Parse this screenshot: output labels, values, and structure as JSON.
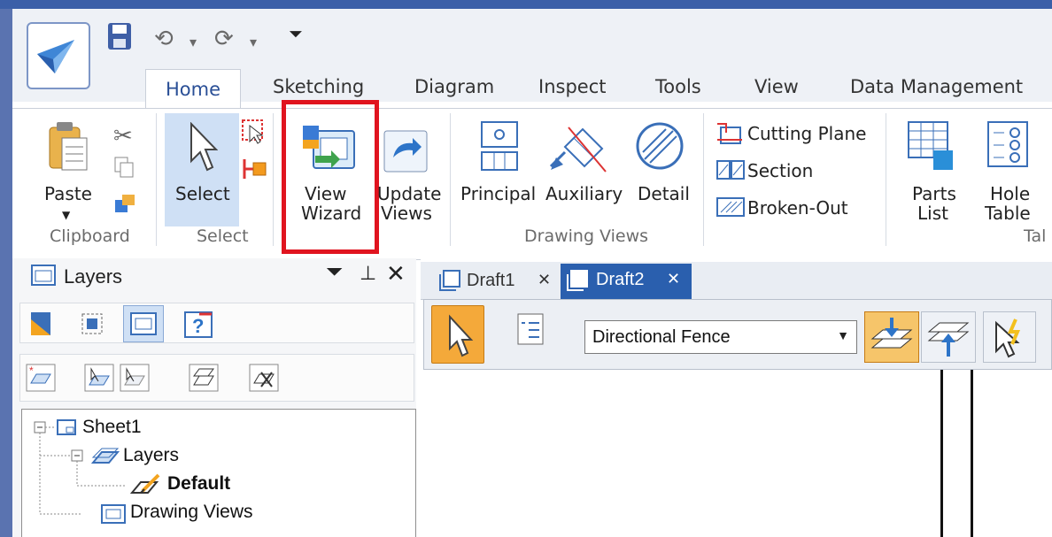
{
  "ribbon_tabs": [
    "Home",
    "Sketching",
    "Diagram",
    "Inspect",
    "Tools",
    "View",
    "Data Management"
  ],
  "clipboard": {
    "paste": "Paste",
    "group": "Clipboard"
  },
  "select": {
    "select": "Select",
    "group": "Select"
  },
  "drawing_views": {
    "view_wizard_line1": "View",
    "view_wizard_line2": "Wizard",
    "update_views_line1": "Update",
    "update_views_line2": "Views",
    "principal": "Principal",
    "auxiliary": "Auxiliary",
    "detail": "Detail",
    "cutting_plane": "Cutting Plane",
    "section": "Section",
    "broken_out": "Broken-Out",
    "group": "Drawing Views"
  },
  "tables": {
    "parts_list_line1": "Parts",
    "parts_list_line2": "List",
    "hole_table_line1": "Hole",
    "hole_table_line2": "Table",
    "group_partial": "Tal"
  },
  "layers_panel": {
    "title": "Layers",
    "tree": {
      "sheet": "Sheet1",
      "layers": "Layers",
      "default": "Default",
      "drawing_views": "Drawing Views"
    }
  },
  "document_tabs": [
    "Draft1",
    "Draft2"
  ],
  "toolbar": {
    "filter_value": "Directional Fence"
  },
  "colors": {
    "highlight": "#e0141f",
    "accent": "#2a4f96",
    "select_bg": "#cfe0f5"
  }
}
